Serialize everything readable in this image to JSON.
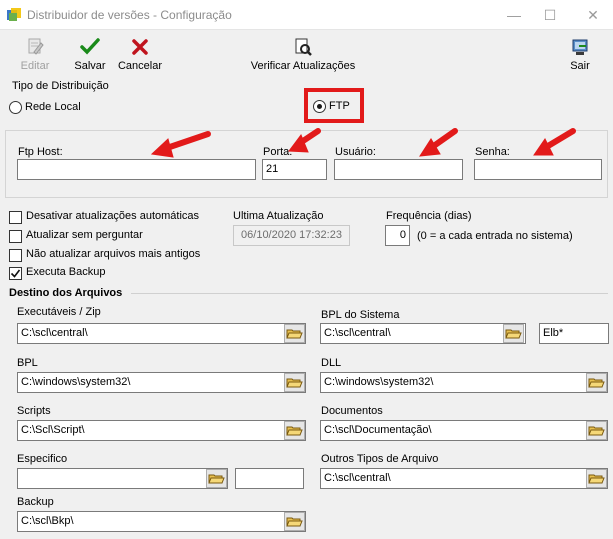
{
  "window": {
    "title": "Distribuidor de versões - Configuração",
    "minimize": "—",
    "maximize": "☐",
    "close": "✕"
  },
  "toolbar": {
    "editar": "Editar",
    "salvar": "Salvar",
    "cancelar": "Cancelar",
    "verificar": "Verificar Atualizações",
    "sair": "Sair"
  },
  "tipo_distribuicao": {
    "label": "Tipo de Distribuição",
    "rede_local": "Rede Local",
    "ftp": "FTP",
    "selected": "FTP"
  },
  "ftp": {
    "host_label": "Ftp Host:",
    "host_value": "",
    "porta_label": "Porta:",
    "porta_value": "21",
    "usuario_label": "Usuário:",
    "usuario_value": "",
    "senha_label": "Senha:",
    "senha_value": ""
  },
  "options": {
    "desativar": "Desativar atualizações automáticas",
    "atualizar_sem": "Atualizar sem perguntar",
    "nao_atualizar": "Não atualizar arquivos mais antigos",
    "executa_backup": "Executa Backup",
    "ultima_label": "Ultima Atualização",
    "ultima_value": "06/10/2020 17:32:23",
    "frequencia_label": "Frequência (dias)",
    "frequencia_value": "0",
    "frequencia_hint": "(0 = a cada entrada no sistema)"
  },
  "destino": {
    "title": "Destino dos Arquivos",
    "executaveis_label": "Executáveis / Zip",
    "executaveis_value": "C:\\scl\\central\\",
    "bpl_sistema_label": "BPL do Sistema",
    "bpl_sistema_value": "C:\\scl\\central\\",
    "bpl_mask_value": "Elb*",
    "bpl_label": "BPL",
    "bpl_value": "C:\\windows\\system32\\",
    "dll_label": "DLL",
    "dll_value": "C:\\windows\\system32\\",
    "scripts_label": "Scripts",
    "scripts_value": "C:\\Scl\\Script\\",
    "documentos_label": "Documentos",
    "documentos_value": "C:\\scl\\Documentação\\",
    "especifico_label": "Especifico",
    "especifico_value": "",
    "especifico_extra_value": "",
    "outros_label": "Outros Tipos de Arquivo",
    "outros_value": "C:\\scl\\central\\",
    "backup_label": "Backup",
    "backup_value": "C:\\scl\\Bkp\\"
  },
  "colors": {
    "annotation_red": "#e21a1a",
    "accent_green": "#1a8a1a",
    "cancel_red": "#c0141e"
  },
  "icons": {
    "editar": "edit-icon",
    "salvar": "checkmark-icon",
    "cancelar": "x-icon",
    "verificar": "document-search-icon",
    "sair": "exit-icon",
    "browse": "folder-open-icon"
  }
}
